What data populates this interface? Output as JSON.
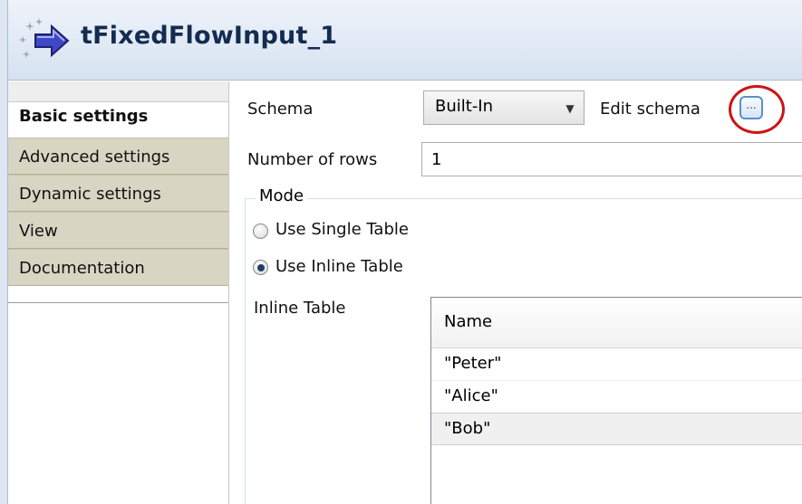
{
  "component": {
    "title": "tFixedFlowInput_1",
    "icon": "fixed-flow-input-icon"
  },
  "tabs": [
    {
      "label": "Basic settings",
      "active": true
    },
    {
      "label": "Advanced settings",
      "active": false
    },
    {
      "label": "Dynamic settings",
      "active": false
    },
    {
      "label": "View",
      "active": false
    },
    {
      "label": "Documentation",
      "active": false
    }
  ],
  "basic": {
    "schema_label": "Schema",
    "schema_value": "Built-In",
    "edit_schema_label": "Edit schema",
    "edit_schema_button": "...",
    "rows_label": "Number of rows",
    "rows_value": "1",
    "mode": {
      "title": "Mode",
      "options": [
        {
          "label": "Use Single Table",
          "checked": false
        },
        {
          "label": "Use Inline Table",
          "checked": true
        }
      ]
    },
    "inline_table": {
      "label": "Inline Table",
      "header": "Name",
      "rows": [
        "\"Peter\"",
        "\"Alice\"",
        "\"Bob\""
      ],
      "selected_row": 2
    }
  },
  "colors": {
    "highlight_circle": "#cc1414",
    "title_text": "#132c4f",
    "tab_bg": "#d9d5c3"
  }
}
